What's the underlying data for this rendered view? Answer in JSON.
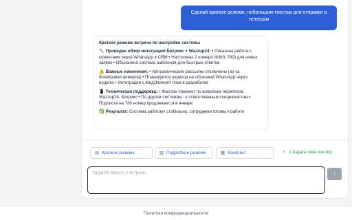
{
  "chat": {
    "user_message": "Сделай краткое резюме, небольшим текстом для отправки в телеграм",
    "bot": {
      "title": "Краткое резюме встречи по настройке системы",
      "sections": [
        {
          "icon": "wrench-icon",
          "emoji": "🔧",
          "heading": "Проведен обзор интеграции Битрикс + Wazzup24:",
          "text": " • Показана работа с клиентами через WhatsApp в CRM • Настроены 2 номера (6363, 780) для новых заявок • Объяснена система шаблонов для быстрых ответов"
        },
        {
          "icon": "warning-icon",
          "emoji": "⚠️",
          "heading": "Важные изменения:",
          "text": " • Автоматические рассылки отключены (из-за блокировки номеров) • Планируется переход на облачный WhatsApp через неделю • Интеграция с МедЭлемент пока в разработке"
        },
        {
          "icon": "phone-icon",
          "emoji": "📱",
          "heading": "Техническая поддержка:",
          "text": " • Жаслан поможет по вопросам переписок, Wazzup24, Битрикс • По другим системам - к ответственным специалистам • Подписка на 780 номер продлевается в январе"
        },
        {
          "icon": "check-icon",
          "emoji": "✅",
          "heading": "Результат:",
          "text": " Система работает стабильно, сотрудники готовы к работе"
        }
      ]
    }
  },
  "quick_actions": {
    "short_summary": "Краткое резюме",
    "detailed_summary": "Подробное резюме",
    "notes": "Конспект",
    "create_button": "Создать свою кнопку"
  },
  "composer": {
    "placeholder": "Задайте вопрос о встрече...",
    "send_icon": "↑"
  },
  "footer": {
    "privacy_link": "Политика конфиденциальности"
  }
}
